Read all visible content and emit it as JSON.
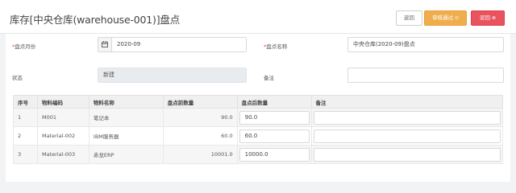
{
  "header": {
    "title": "库存[中央仓库(warehouse-001)]盘点",
    "back_label": "返回",
    "approve_label": "审核通过",
    "reject_label": "驳回"
  },
  "form": {
    "month_label": "盘点月份",
    "month_value": "2020-09",
    "name_label": "盘点名称",
    "name_value": "中央仓库(2020-09)盘点",
    "status_label": "状态",
    "status_value": "新建",
    "remark_label": "备注",
    "remark_value": ""
  },
  "table": {
    "columns": [
      "序号",
      "物料编码",
      "物料名称",
      "盘点前数量",
      "盘点后数量",
      "备注"
    ],
    "rows": [
      {
        "seq": "1",
        "code": "M001",
        "name": "笔记本",
        "before": "90.0",
        "after": "90.0",
        "remark": ""
      },
      {
        "seq": "2",
        "code": "Material-002",
        "name": "IBM服务器",
        "before": "60.0",
        "after": "60.0",
        "remark": ""
      },
      {
        "seq": "3",
        "code": "Material-003",
        "name": "赤龙ERP",
        "before": "10001.0",
        "after": "10000.0",
        "remark": ""
      }
    ]
  },
  "icons": {
    "approve": "check-circle-icon",
    "reject": "close-circle-icon",
    "calendar": "calendar-icon"
  },
  "colors": {
    "approve": "#f0ad4e",
    "reject": "#e9535e",
    "required": "#e23d49"
  }
}
